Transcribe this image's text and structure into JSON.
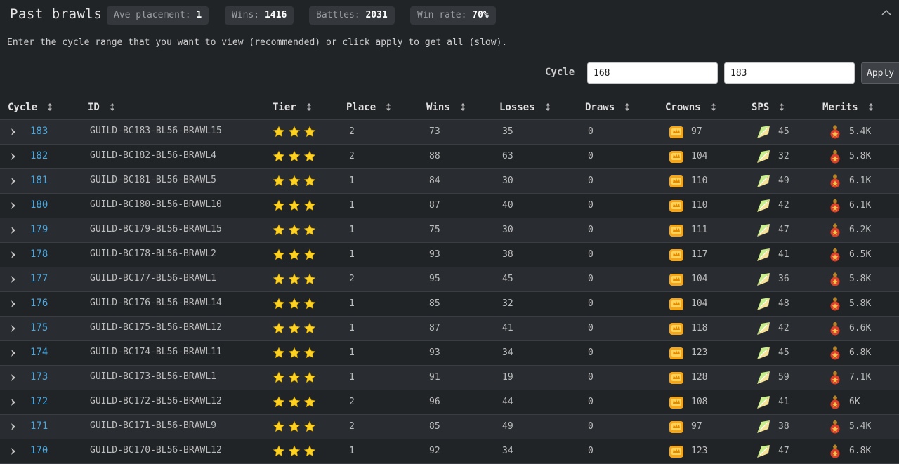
{
  "header": {
    "title": "Past brawls",
    "stats": [
      {
        "label": "Ave placement:",
        "value": "1"
      },
      {
        "label": "Wins:",
        "value": "1416"
      },
      {
        "label": "Battles:",
        "value": "2031"
      },
      {
        "label": "Win rate:",
        "value": "70%"
      }
    ],
    "collapse_icon": "chevron-up-icon"
  },
  "hint": "Enter the cycle range that you want to view (recommended) or click apply to get all (slow).",
  "filter": {
    "label": "Cycle",
    "from_value": "168",
    "to_value": "183",
    "apply_label": "Apply"
  },
  "table": {
    "columns": [
      "Cycle",
      "ID",
      "Tier",
      "Place",
      "Wins",
      "Losses",
      "Draws",
      "Crowns",
      "SPS",
      "Merits"
    ],
    "tier_stars": 3,
    "colors": {
      "link": "#4aa8e0",
      "star": "#ffd21f",
      "crown": "#f3a51c",
      "merit": "#d8402c"
    },
    "rows": [
      {
        "cycle": "183",
        "id": "GUILD-BC183-BL56-BRAWL15",
        "place": "2",
        "wins": "73",
        "losses": "35",
        "draws": "0",
        "crowns": "97",
        "sps": "45",
        "merits": "5.4K"
      },
      {
        "cycle": "182",
        "id": "GUILD-BC182-BL56-BRAWL4",
        "place": "2",
        "wins": "88",
        "losses": "63",
        "draws": "0",
        "crowns": "104",
        "sps": "32",
        "merits": "5.8K"
      },
      {
        "cycle": "181",
        "id": "GUILD-BC181-BL56-BRAWL5",
        "place": "1",
        "wins": "84",
        "losses": "30",
        "draws": "0",
        "crowns": "110",
        "sps": "49",
        "merits": "6.1K"
      },
      {
        "cycle": "180",
        "id": "GUILD-BC180-BL56-BRAWL10",
        "place": "1",
        "wins": "87",
        "losses": "40",
        "draws": "0",
        "crowns": "110",
        "sps": "42",
        "merits": "6.1K"
      },
      {
        "cycle": "179",
        "id": "GUILD-BC179-BL56-BRAWL15",
        "place": "1",
        "wins": "75",
        "losses": "30",
        "draws": "0",
        "crowns": "111",
        "sps": "47",
        "merits": "6.2K"
      },
      {
        "cycle": "178",
        "id": "GUILD-BC178-BL56-BRAWL2",
        "place": "1",
        "wins": "93",
        "losses": "38",
        "draws": "0",
        "crowns": "117",
        "sps": "41",
        "merits": "6.5K"
      },
      {
        "cycle": "177",
        "id": "GUILD-BC177-BL56-BRAWL1",
        "place": "2",
        "wins": "95",
        "losses": "45",
        "draws": "0",
        "crowns": "104",
        "sps": "36",
        "merits": "5.8K"
      },
      {
        "cycle": "176",
        "id": "GUILD-BC176-BL56-BRAWL14",
        "place": "1",
        "wins": "85",
        "losses": "32",
        "draws": "0",
        "crowns": "104",
        "sps": "48",
        "merits": "5.8K"
      },
      {
        "cycle": "175",
        "id": "GUILD-BC175-BL56-BRAWL12",
        "place": "1",
        "wins": "87",
        "losses": "41",
        "draws": "0",
        "crowns": "118",
        "sps": "42",
        "merits": "6.6K"
      },
      {
        "cycle": "174",
        "id": "GUILD-BC174-BL56-BRAWL11",
        "place": "1",
        "wins": "93",
        "losses": "34",
        "draws": "0",
        "crowns": "123",
        "sps": "45",
        "merits": "6.8K"
      },
      {
        "cycle": "173",
        "id": "GUILD-BC173-BL56-BRAWL1",
        "place": "1",
        "wins": "91",
        "losses": "19",
        "draws": "0",
        "crowns": "128",
        "sps": "59",
        "merits": "7.1K"
      },
      {
        "cycle": "172",
        "id": "GUILD-BC172-BL56-BRAWL12",
        "place": "2",
        "wins": "96",
        "losses": "44",
        "draws": "0",
        "crowns": "108",
        "sps": "41",
        "merits": "6K"
      },
      {
        "cycle": "171",
        "id": "GUILD-BC171-BL56-BRAWL9",
        "place": "2",
        "wins": "85",
        "losses": "49",
        "draws": "0",
        "crowns": "97",
        "sps": "38",
        "merits": "5.4K"
      },
      {
        "cycle": "170",
        "id": "GUILD-BC170-BL56-BRAWL12",
        "place": "1",
        "wins": "92",
        "losses": "34",
        "draws": "0",
        "crowns": "123",
        "sps": "47",
        "merits": "6.8K"
      }
    ]
  }
}
